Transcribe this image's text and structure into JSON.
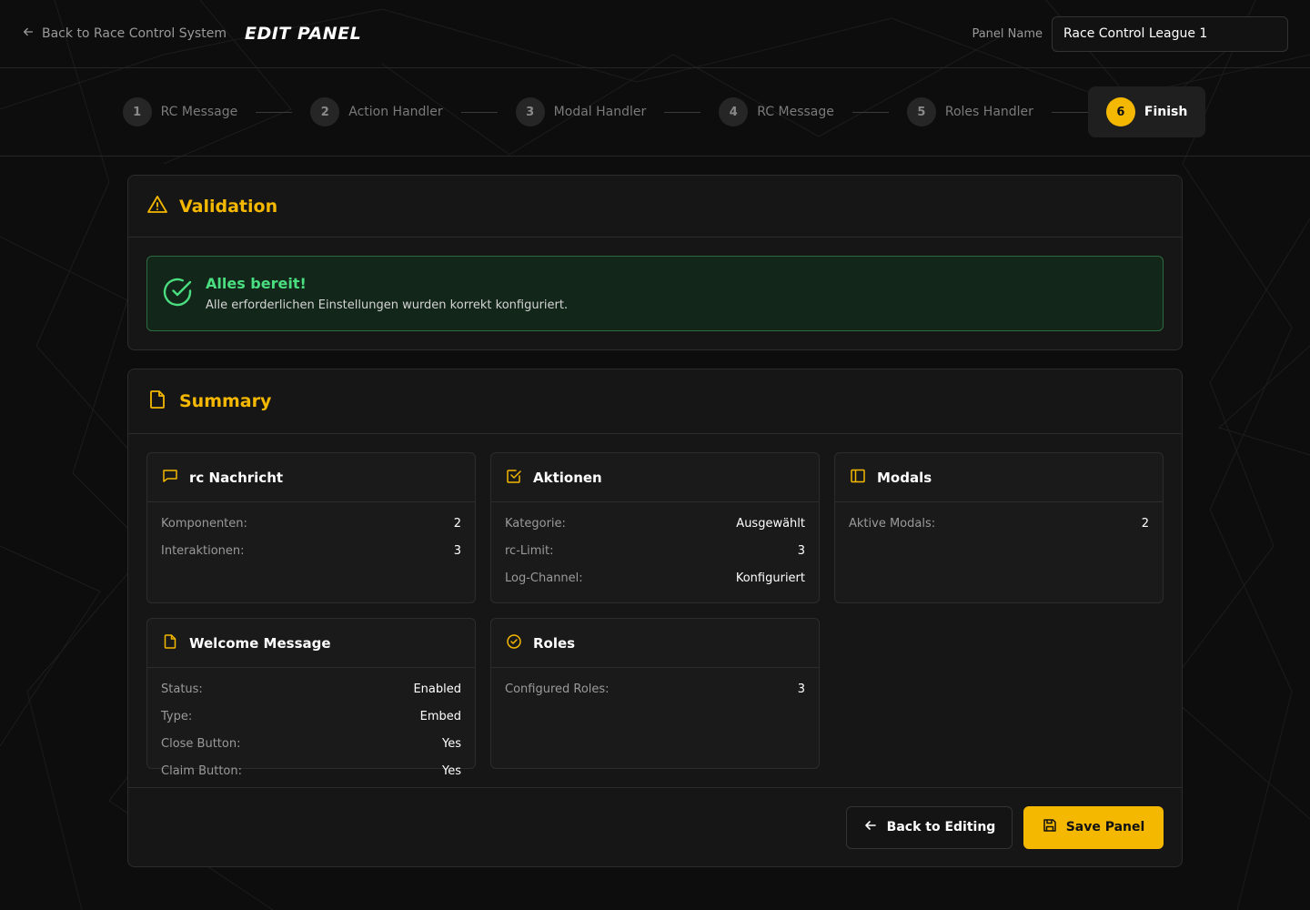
{
  "header": {
    "back_label": "Back to Race Control System",
    "title": "EDIT PANEL",
    "panel_name_label": "Panel Name",
    "panel_name_value": "Race Control League 1"
  },
  "stepper": {
    "steps": [
      {
        "num": "1",
        "label": "RC Message"
      },
      {
        "num": "2",
        "label": "Action Handler"
      },
      {
        "num": "3",
        "label": "Modal Handler"
      },
      {
        "num": "4",
        "label": "RC Message"
      },
      {
        "num": "5",
        "label": "Roles Handler"
      },
      {
        "num": "6",
        "label": "Finish"
      }
    ],
    "active_step": 6
  },
  "validation": {
    "title": "Validation",
    "status_title": "Alles bereit!",
    "status_text": "Alle erforderlichen Einstellungen wurden korrekt konfiguriert."
  },
  "summary": {
    "title": "Summary",
    "cards": {
      "rc_nachricht": {
        "title": "rc Nachricht",
        "rows": [
          {
            "k": "Komponenten:",
            "v": "2"
          },
          {
            "k": "Interaktionen:",
            "v": "3"
          }
        ]
      },
      "aktionen": {
        "title": "Aktionen",
        "rows": [
          {
            "k": "Kategorie:",
            "v": "Ausgewählt"
          },
          {
            "k": "rc-Limit:",
            "v": "3"
          },
          {
            "k": "Log-Channel:",
            "v": "Konfiguriert"
          }
        ]
      },
      "modals": {
        "title": "Modals",
        "rows": [
          {
            "k": "Aktive Modals:",
            "v": "2"
          }
        ]
      },
      "welcome": {
        "title": "Welcome Message",
        "rows": [
          {
            "k": "Status:",
            "v": "Enabled"
          },
          {
            "k": "Type:",
            "v": "Embed"
          },
          {
            "k": "Close Button:",
            "v": "Yes"
          },
          {
            "k": "Claim Button:",
            "v": "Yes"
          }
        ]
      },
      "roles": {
        "title": "Roles",
        "rows": [
          {
            "k": "Configured Roles:",
            "v": "3"
          }
        ]
      }
    }
  },
  "footer": {
    "back_label": "Back to Editing",
    "save_label": "Save Panel"
  },
  "colors": {
    "accent": "#f5b800",
    "success": "#4ade80",
    "background": "#0d0d0d"
  }
}
